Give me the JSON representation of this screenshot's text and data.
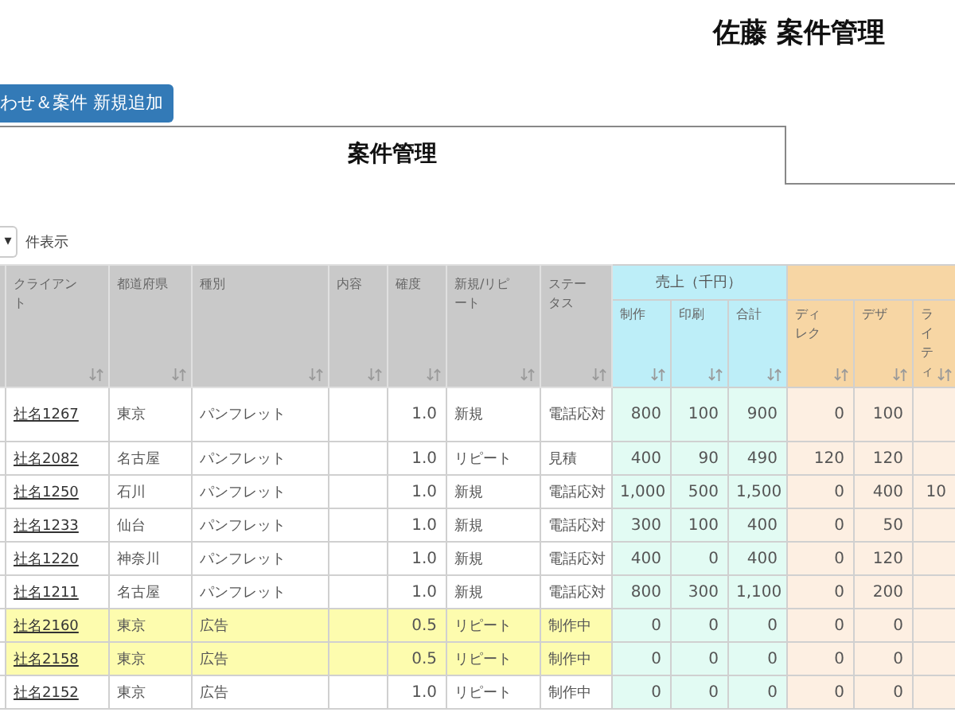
{
  "page_title": "佐藤 案件管理",
  "add_button": {
    "label": "わせ＆案件 新規追加"
  },
  "tabs": [
    {
      "label": "案件管理",
      "selected": true
    }
  ],
  "page_length": {
    "arrow": "▾",
    "suffix": "件表示"
  },
  "table": {
    "column_groups": [
      {
        "kind": "plain",
        "columns": [
          {
            "label": "クライアント",
            "kind": "link"
          },
          {
            "label": "都道府県",
            "kind": "text"
          },
          {
            "label": "種別",
            "kind": "text"
          },
          {
            "label": "内容",
            "kind": "text"
          },
          {
            "label": "確度",
            "kind": "number"
          },
          {
            "label": "新規/リピート",
            "kind": "text"
          },
          {
            "label": "ステータス",
            "kind": "text"
          }
        ]
      },
      {
        "kind": "sales",
        "label": "売上（千円）",
        "columns": [
          {
            "label": "制作",
            "kind": "number"
          },
          {
            "label": "印刷",
            "kind": "number"
          },
          {
            "label": "合計",
            "kind": "number"
          }
        ]
      },
      {
        "kind": "cost",
        "columns": [
          {
            "label": "ディレク",
            "kind": "number"
          },
          {
            "label": "デザ",
            "kind": "number"
          },
          {
            "label": "ライティ",
            "kind": "number"
          }
        ]
      }
    ],
    "rows": [
      {
        "highlighted": false,
        "cells": [
          "社名1267",
          "東京",
          "パンフレット",
          null,
          "1.0",
          "新規",
          "電話応対",
          "800",
          "100",
          "900",
          "0",
          "100",
          null
        ]
      },
      {
        "highlighted": false,
        "cells": [
          "社名2082",
          "名古屋",
          "パンフレット",
          null,
          "1.0",
          "リピート",
          "見積",
          "400",
          "90",
          "490",
          "120",
          "120",
          null
        ]
      },
      {
        "highlighted": false,
        "cells": [
          "社名1250",
          "石川",
          "パンフレット",
          null,
          "1.0",
          "新規",
          "電話応対",
          "1,000",
          "500",
          "1,500",
          "0",
          "400",
          "10"
        ]
      },
      {
        "highlighted": false,
        "cells": [
          "社名1233",
          "仙台",
          "パンフレット",
          null,
          "1.0",
          "新規",
          "電話応対",
          "300",
          "100",
          "400",
          "0",
          "50",
          null
        ]
      },
      {
        "highlighted": false,
        "cells": [
          "社名1220",
          "神奈川",
          "パンフレット",
          null,
          "1.0",
          "新規",
          "電話応対",
          "400",
          "0",
          "400",
          "0",
          "120",
          null
        ]
      },
      {
        "highlighted": false,
        "cells": [
          "社名1211",
          "名古屋",
          "パンフレット",
          null,
          "1.0",
          "新規",
          "電話応対",
          "800",
          "300",
          "1,100",
          "0",
          "200",
          null
        ]
      },
      {
        "highlighted": true,
        "cells": [
          "社名2160",
          "東京",
          "広告",
          null,
          "0.5",
          "リピート",
          "制作中",
          "0",
          "0",
          "0",
          "0",
          "0",
          null
        ]
      },
      {
        "highlighted": true,
        "cells": [
          "社名2158",
          "東京",
          "広告",
          null,
          "0.5",
          "リピート",
          "制作中",
          "0",
          "0",
          "0",
          "0",
          "0",
          null
        ]
      },
      {
        "highlighted": false,
        "cells": [
          "社名2152",
          "東京",
          "広告",
          null,
          "1.0",
          "リピート",
          "制作中",
          "0",
          "0",
          "0",
          "0",
          "0",
          null
        ]
      }
    ]
  }
}
